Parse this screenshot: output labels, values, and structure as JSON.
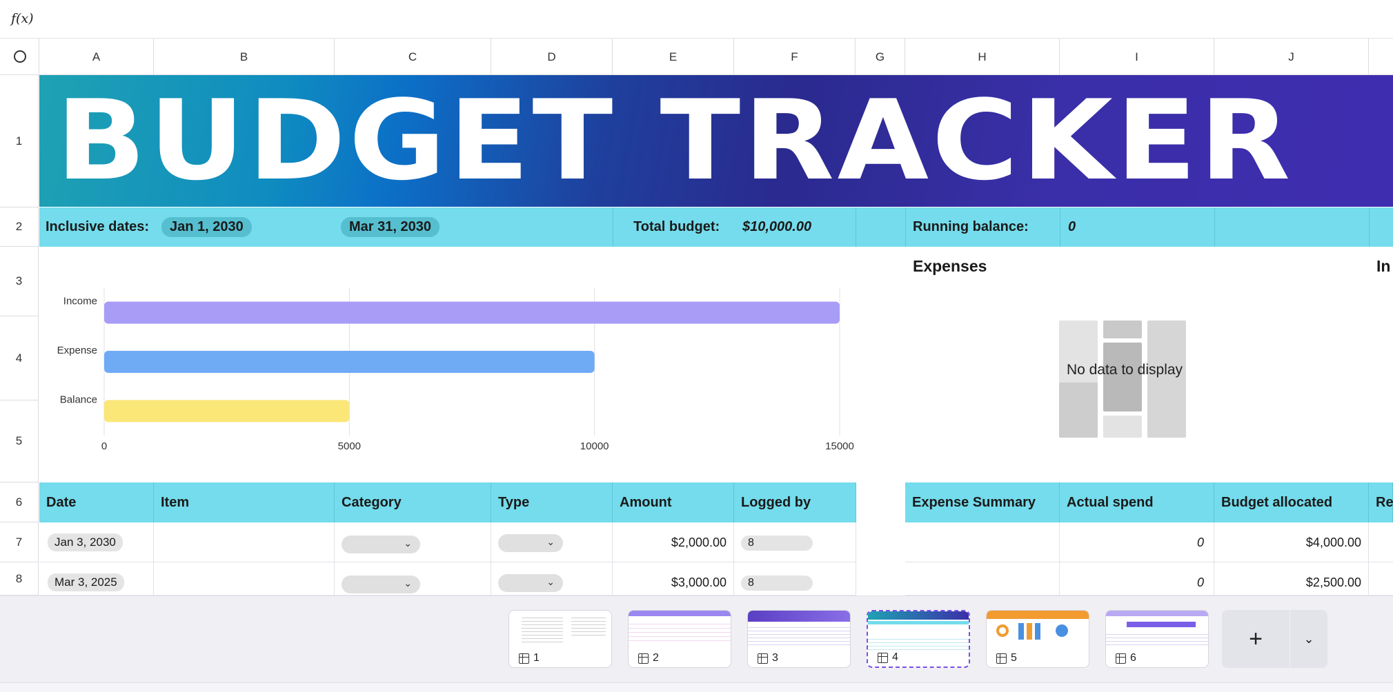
{
  "formula_bar": {
    "label": "f(x)"
  },
  "columns": [
    "A",
    "B",
    "C",
    "D",
    "E",
    "F",
    "G",
    "H",
    "I",
    "J"
  ],
  "rows": [
    "1",
    "2",
    "3",
    "4",
    "5",
    "6",
    "7",
    "8"
  ],
  "banner": {
    "title": "BUDGET TRACKER"
  },
  "summary_row": {
    "inclusive_label": "Inclusive dates:",
    "start_date": "Jan 1, 2030",
    "end_date": "Mar 31, 2030",
    "total_budget_label": "Total budget:",
    "total_budget_value": "$10,000.00",
    "running_balance_label": "Running balance:",
    "running_balance_value": "0"
  },
  "sections": {
    "expenses": "Expenses",
    "income_partial": "In"
  },
  "chart_data": {
    "type": "bar",
    "orientation": "horizontal",
    "categories": [
      "Income",
      "Expense",
      "Balance"
    ],
    "values": [
      15000,
      10000,
      5000
    ],
    "colors": [
      "#a99cf6",
      "#6faaf5",
      "#fbe678"
    ],
    "xlim": [
      0,
      15000
    ],
    "xticks": [
      "0",
      "5000",
      "10000",
      "15000"
    ],
    "grid": true
  },
  "no_data": {
    "text": "No data to display"
  },
  "table": {
    "headers": [
      "Date",
      "Item",
      "Category",
      "Type",
      "Amount",
      "Logged by"
    ],
    "rows": [
      {
        "date": "Jan 3, 2030",
        "amount": "$2,000.00",
        "logged_by": "8"
      },
      {
        "date": "Mar 3, 2025",
        "amount": "$3,000.00",
        "logged_by": "8"
      }
    ]
  },
  "summary_table": {
    "headers": [
      "Expense Summary",
      "Actual spend",
      "Budget allocated",
      "Re"
    ],
    "rows": [
      {
        "actual": "0",
        "budget": "$4,000.00"
      },
      {
        "actual": "0",
        "budget": "$2,500.00"
      }
    ]
  },
  "sheets": [
    {
      "label": "1"
    },
    {
      "label": "2"
    },
    {
      "label": "3"
    },
    {
      "label": "4",
      "active": true
    },
    {
      "label": "5"
    },
    {
      "label": "6"
    }
  ],
  "sheet_controls": {
    "add": "+",
    "more": "⌄"
  }
}
